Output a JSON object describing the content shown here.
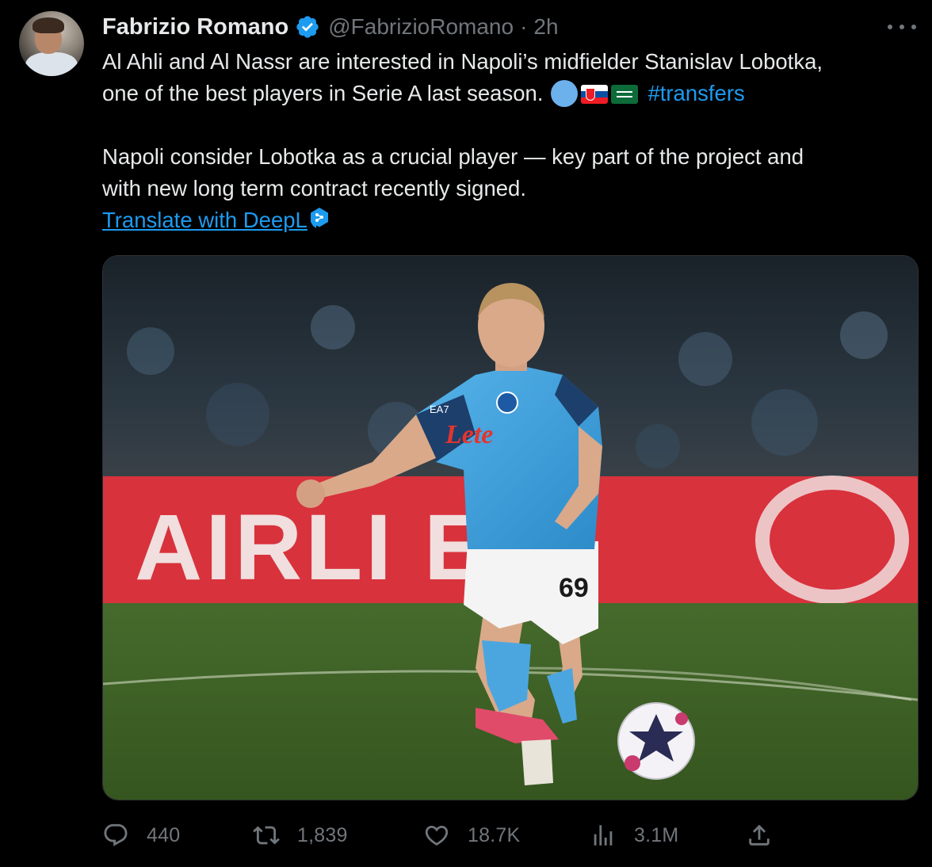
{
  "tweet": {
    "author": {
      "name": "Fabrizio Romano",
      "handle": "@FabrizioRomano",
      "separator": "·",
      "time": "2h"
    },
    "text": {
      "line1": "Al Ahli and Al Nassr are interested in Napoli’s midfielder Stanislav Lobotka,",
      "line2": "one of the best players in Serie A last season.",
      "hashtag": "#transfers",
      "line3": "Napoli consider Lobotka as a crucial player — key part of the project and",
      "line4": "with new long term contract recently signed."
    },
    "translate_link": "Translate with DeepL",
    "media": {
      "banner_text": "AIRLI ES",
      "shirt_sponsor": "Lete",
      "shirt_number": "69",
      "shirt_brand": "EA7"
    },
    "stats": {
      "replies": "440",
      "retweets": "1,839",
      "likes": "18.7K",
      "views": "3.1M"
    },
    "icons": {
      "verified": "verified-badge-icon",
      "more": "more-icon",
      "reply": "reply-icon",
      "retweet": "retweet-icon",
      "like": "heart-icon",
      "views": "views-icon",
      "share": "share-icon",
      "deepl": "deepl-icon"
    },
    "colors": {
      "background": "#000000",
      "text": "#e7e9ea",
      "muted": "#71767b",
      "link": "#1d9bf0",
      "verified": "#1d9bf0"
    }
  }
}
